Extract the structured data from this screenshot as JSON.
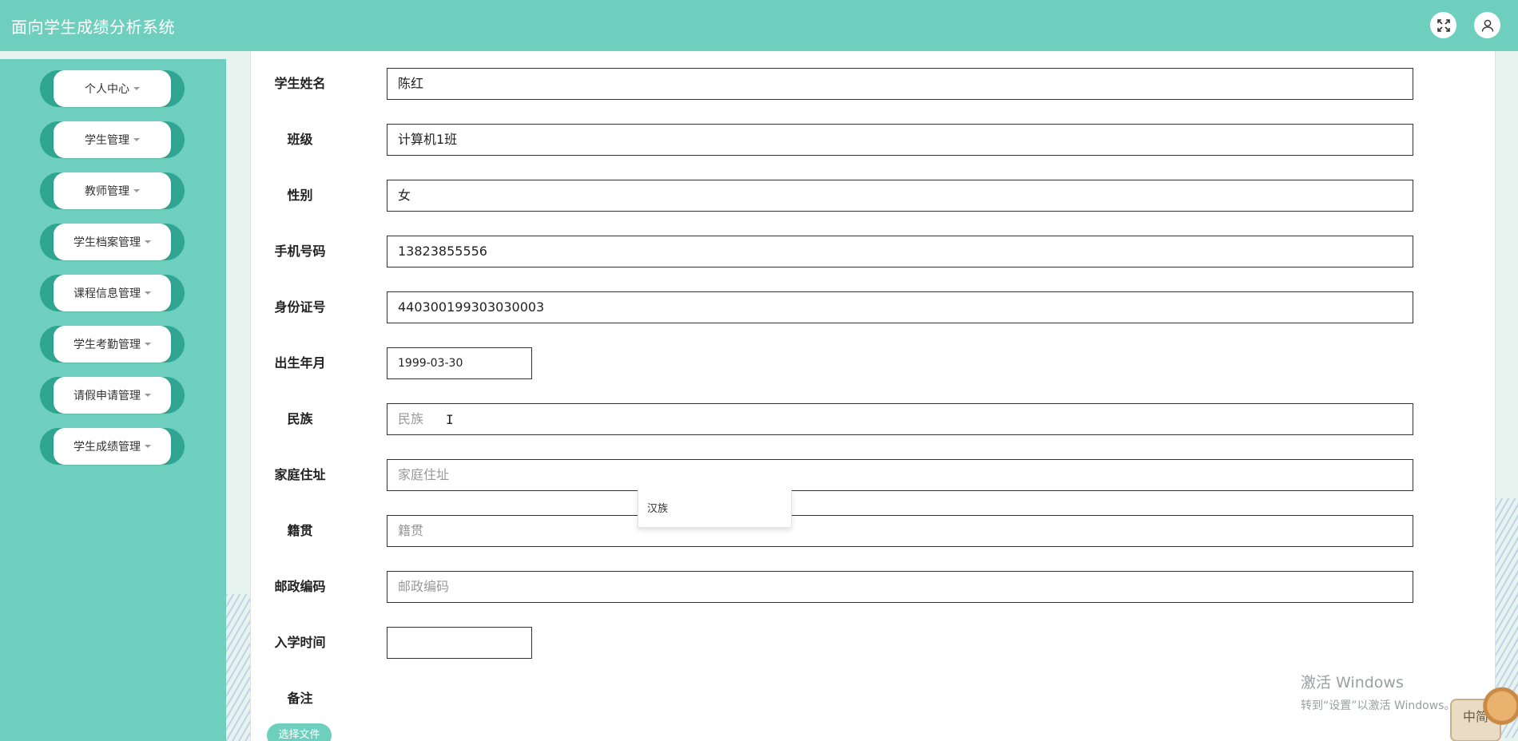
{
  "header": {
    "title": "面向学生成绩分析系统",
    "fullscreen_icon": "expand-icon",
    "user_icon": "user-icon"
  },
  "sidebar": {
    "items": [
      {
        "label": "个人中心"
      },
      {
        "label": "学生管理"
      },
      {
        "label": "教师管理"
      },
      {
        "label": "学生档案管理"
      },
      {
        "label": "课程信息管理"
      },
      {
        "label": "学生考勤管理"
      },
      {
        "label": "请假申请管理"
      },
      {
        "label": "学生成绩管理"
      }
    ]
  },
  "form": {
    "fields": [
      {
        "label": "学生姓名",
        "value": "陈红",
        "placeholder": ""
      },
      {
        "label": "班级",
        "value": "计算机1班",
        "placeholder": ""
      },
      {
        "label": "性别",
        "value": "女",
        "placeholder": ""
      },
      {
        "label": "手机号码",
        "value": "13823855556",
        "placeholder": ""
      },
      {
        "label": "身份证号",
        "value": "440300199303030003",
        "placeholder": ""
      },
      {
        "label": "出生年月",
        "value": "1999-03-30",
        "placeholder": ""
      },
      {
        "label": "民族",
        "value": "",
        "placeholder": "民族"
      },
      {
        "label": "家庭住址",
        "value": "",
        "placeholder": "家庭住址"
      },
      {
        "label": "籍贯",
        "value": "",
        "placeholder": "籍贯"
      },
      {
        "label": "邮政编码",
        "value": "",
        "placeholder": "邮政编码"
      },
      {
        "label": "入学时间",
        "value": "",
        "placeholder": ""
      },
      {
        "label": "备注"
      }
    ],
    "ethnicity_dropdown": {
      "option": "汉族"
    },
    "file_button_label": "选择文件"
  },
  "watermark": {
    "line1": "激活 Windows",
    "line2": "转到“设置”以激活 Windows。"
  },
  "ime": {
    "label": "中简"
  },
  "colors": {
    "primary": "#6fcfbf",
    "sidebar_pill_edge": "#2fa592",
    "background": "#e6f3ef"
  }
}
